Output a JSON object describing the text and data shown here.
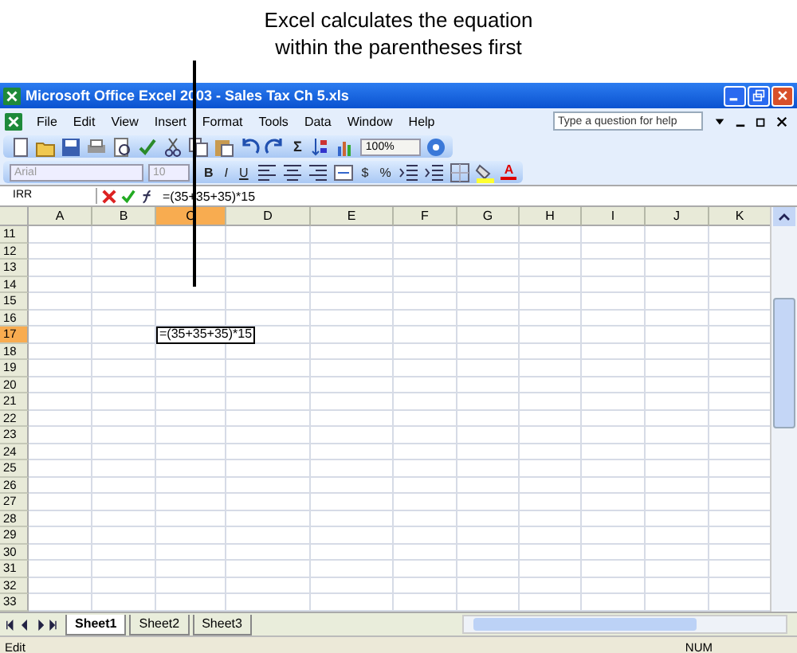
{
  "callout": {
    "lines": [
      "Excel calculates the equation",
      "within the parentheses first"
    ]
  },
  "window": {
    "title": "Microsoft Office Excel 2003 - Sales Tax Ch 5.xls"
  },
  "menu": [
    "File",
    "Edit",
    "View",
    "Insert",
    "Format",
    "Tools",
    "Data",
    "Window",
    "Help"
  ],
  "help_box": {
    "placeholder": "Type a question for help"
  },
  "standard_toolbar": {
    "autosum": "Σ",
    "zoom": "100%"
  },
  "formatting_toolbar": {
    "font": {
      "value": "Arial",
      "disabled": true
    },
    "size": {
      "value": "10",
      "disabled": true
    },
    "style_buttons": [
      "B",
      "I",
      "U"
    ],
    "number_buttons": [
      "$",
      "%"
    ],
    "font_color": "A"
  },
  "formula_bar": {
    "name_box": "IRR",
    "formula": "=(35+35+35)*15"
  },
  "columns": [
    {
      "label": "A",
      "selected": false
    },
    {
      "label": "B",
      "selected": false
    },
    {
      "label": "C",
      "selected": true
    },
    {
      "label": "D",
      "selected": false
    },
    {
      "label": "E",
      "selected": false
    },
    {
      "label": "F",
      "selected": false
    },
    {
      "label": "G",
      "selected": false
    },
    {
      "label": "H",
      "selected": false
    },
    {
      "label": "I",
      "selected": false
    },
    {
      "label": "J",
      "selected": false
    },
    {
      "label": "K",
      "selected": false
    }
  ],
  "rows": [
    {
      "label": "11",
      "selected": false
    },
    {
      "label": "12",
      "selected": false
    },
    {
      "label": "13",
      "selected": false
    },
    {
      "label": "14",
      "selected": false
    },
    {
      "label": "15",
      "selected": false
    },
    {
      "label": "16",
      "selected": false
    },
    {
      "label": "17",
      "selected": true,
      "edit_text": "=(35+35+35)*15"
    },
    {
      "label": "18",
      "selected": false
    },
    {
      "label": "19",
      "selected": false
    },
    {
      "label": "20",
      "selected": false
    },
    {
      "label": "21",
      "selected": false
    },
    {
      "label": "22",
      "selected": false
    },
    {
      "label": "23",
      "selected": false
    },
    {
      "label": "24",
      "selected": false
    },
    {
      "label": "25",
      "selected": false
    },
    {
      "label": "26",
      "selected": false
    },
    {
      "label": "27",
      "selected": false
    },
    {
      "label": "28",
      "selected": false
    },
    {
      "label": "29",
      "selected": false
    },
    {
      "label": "30",
      "selected": false
    },
    {
      "label": "31",
      "selected": false
    },
    {
      "label": "32",
      "selected": false
    },
    {
      "label": "33",
      "selected": false
    }
  ],
  "sheet_tabs": [
    {
      "label": "Sheet1",
      "selected": true
    },
    {
      "label": "Sheet2",
      "selected": false
    },
    {
      "label": "Sheet3",
      "selected": false
    }
  ],
  "status_bar": {
    "mode": "Edit",
    "indicator": "NUM"
  }
}
